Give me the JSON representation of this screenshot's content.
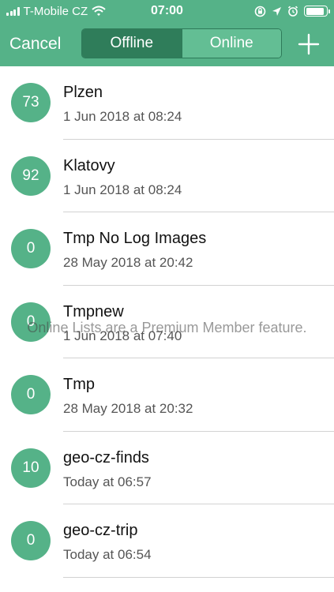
{
  "status_bar": {
    "carrier": "T-Mobile CZ",
    "time": "07:00",
    "battery_level": 0.9
  },
  "nav": {
    "cancel_label": "Cancel",
    "segments": [
      {
        "label": "Offline",
        "selected": true
      },
      {
        "label": "Online",
        "selected": false
      }
    ],
    "add_icon": "plus-icon"
  },
  "lists": [
    {
      "count": "73",
      "name": "Plzen",
      "date": "1 Jun 2018 at 08:24"
    },
    {
      "count": "92",
      "name": "Klatovy",
      "date": "1 Jun 2018 at 08:24"
    },
    {
      "count": "0",
      "name": "Tmp No Log Images",
      "date": "28 May 2018 at 20:42"
    },
    {
      "count": "0",
      "name": "Tmpnew",
      "date": "1 Jun 2018 at 07:40"
    },
    {
      "count": "0",
      "name": "Tmp",
      "date": "28 May 2018 at 20:32"
    },
    {
      "count": "10",
      "name": "geo-cz-finds",
      "date": "Today at 06:57"
    },
    {
      "count": "0",
      "name": "geo-cz-trip",
      "date": "Today at 06:54"
    }
  ],
  "overlay_message": "Online Lists are a Premium Member feature.",
  "colors": {
    "accent": "#55b288",
    "segment_active": "#2f7d5a",
    "segment_inactive": "#63be94"
  }
}
